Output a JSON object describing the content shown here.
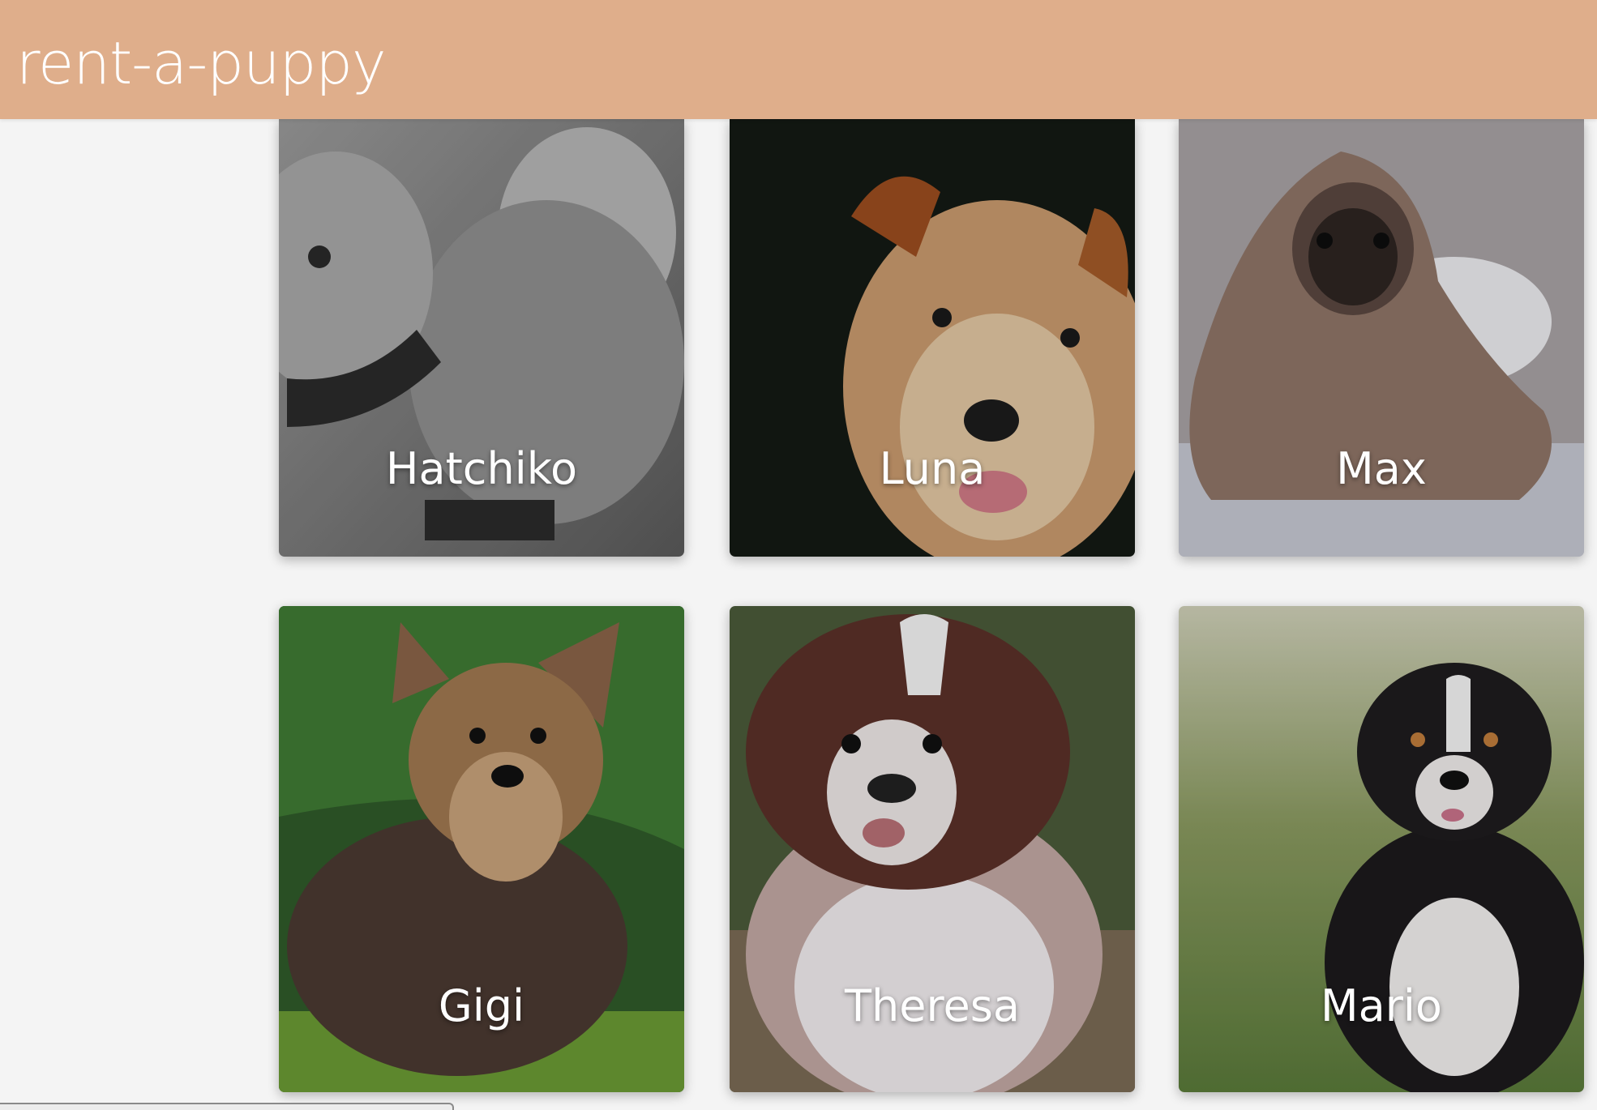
{
  "header": {
    "title": "rent-a-puppy",
    "background": "#dfae8b"
  },
  "puppies": [
    {
      "name": "Hatchiko"
    },
    {
      "name": "Luna"
    },
    {
      "name": "Max"
    },
    {
      "name": "Gigi"
    },
    {
      "name": "Theresa"
    },
    {
      "name": "Mario"
    }
  ]
}
